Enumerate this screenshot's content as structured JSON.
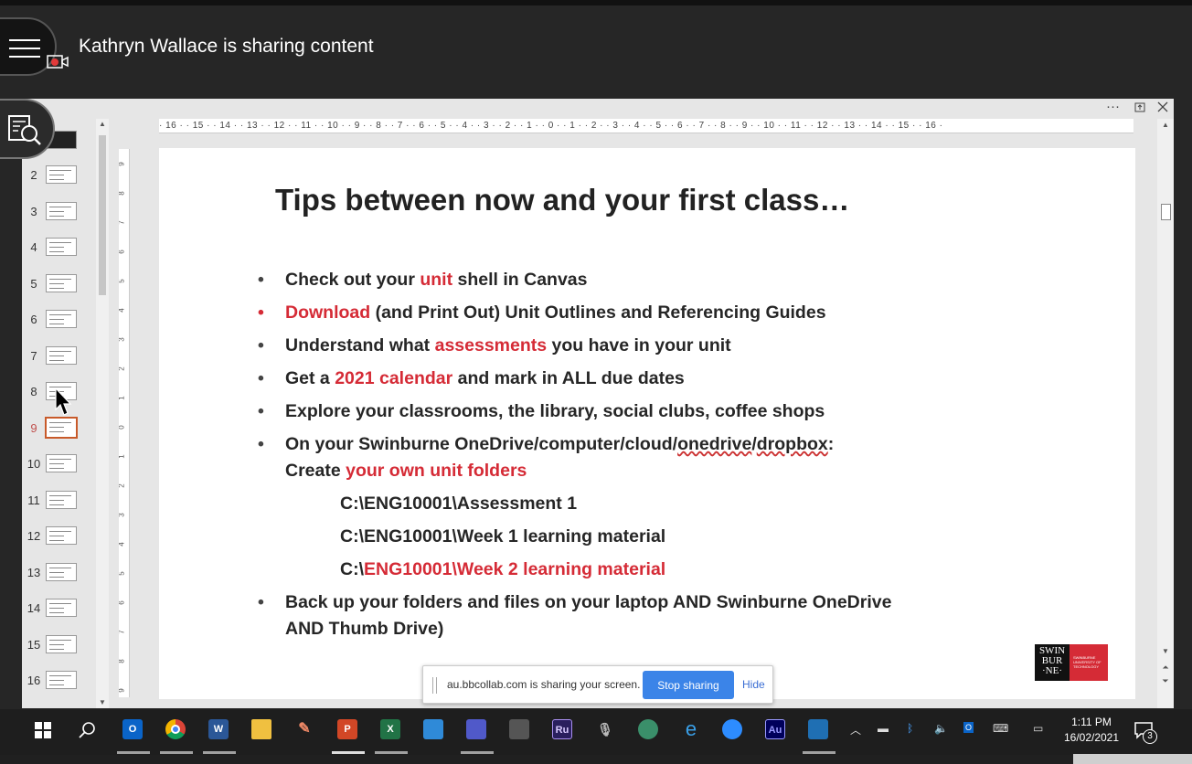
{
  "header": {
    "share_title": "Kathryn Wallace is sharing content"
  },
  "thumbnails": {
    "numbers": [
      "2",
      "3",
      "4",
      "5",
      "6",
      "7",
      "8",
      "9",
      "10",
      "11",
      "12",
      "13",
      "14",
      "15",
      "16"
    ],
    "selected": "9"
  },
  "ruler": {
    "ticks": "· 16 · · 15 · · 14 · · 13 · · 12 · · 11 · · 10 · · 9 · · 8 · · 7 · · 6 · · 5 · · 4 · · 3 · · 2 · · 1 · · 0 · · 1 · · 2 · · 3 · · 4 · · 5 · · 6 · · 7 · · 8 · · 9 · · 10 · · 11 · · 12 · · 13 · · 14 · · 15 · · 16 ·"
  },
  "slide": {
    "title": "Tips between now and your first class…",
    "b1": {
      "a": "Check out your ",
      "r": "unit",
      "c": " shell in Canvas"
    },
    "b2": {
      "r": "Download",
      "c": " (and Print Out) Unit Outlines and Referencing Guides"
    },
    "b3": {
      "a": "Understand what ",
      "r": "assessments",
      "c": " you have in your unit"
    },
    "b4": {
      "a": "Get a ",
      "r": "2021 calendar",
      "c": " and mark in ALL due dates"
    },
    "b5": {
      "a": "Explore your classrooms, the library, social clubs, coffee shops"
    },
    "b6": {
      "a": "On your Swinburne OneDrive/computer/cloud/",
      "u1": "onedrive",
      "s": "/",
      "u2": "dropbox",
      "c": ":",
      "l2a": "Create ",
      "l2r": "your own unit folders"
    },
    "p1": "C:\\ENG10001\\Assessment 1",
    "p2": "C:\\ENG10001\\Week 1 learning material",
    "p3": {
      "a": "C:\\",
      "r": "ENG10001\\Week 2 learning material"
    },
    "b7": {
      "l1": "Back up your folders and files on your laptop AND Swinburne OneDrive",
      "l2": "AND Thumb Drive)"
    },
    "bullet": "•",
    "logo": {
      "l1": "SWIN",
      "l2": "BUR",
      "l3": "·NE·",
      "sub": "SWINBURNE UNIVERSITY OF TECHNOLOGY"
    }
  },
  "share_bar": {
    "message": "au.bbcollab.com is sharing your screen.",
    "stop_label": "Stop sharing",
    "hide_label": "Hide"
  },
  "taskbar": {
    "apps": [
      "outlook",
      "chrome",
      "word",
      "file-explorer",
      "paint",
      "powerpoint",
      "excel",
      "onedrive",
      "teams",
      "camera",
      "rush",
      "microphone",
      "globe",
      "edge",
      "zoom",
      "audition",
      "photos"
    ],
    "labels": {
      "outlook": "O",
      "word": "W",
      "powerpoint": "P",
      "excel": "X",
      "rush": "Ru",
      "audition": "Au",
      "edge": "e"
    },
    "time": "1:11 PM",
    "date": "16/02/2021",
    "notif_count": "3"
  },
  "colors": {
    "accent_red": "#d52b36",
    "stop_button": "#3b84e8",
    "selected_thumb": "#c85a2a"
  }
}
